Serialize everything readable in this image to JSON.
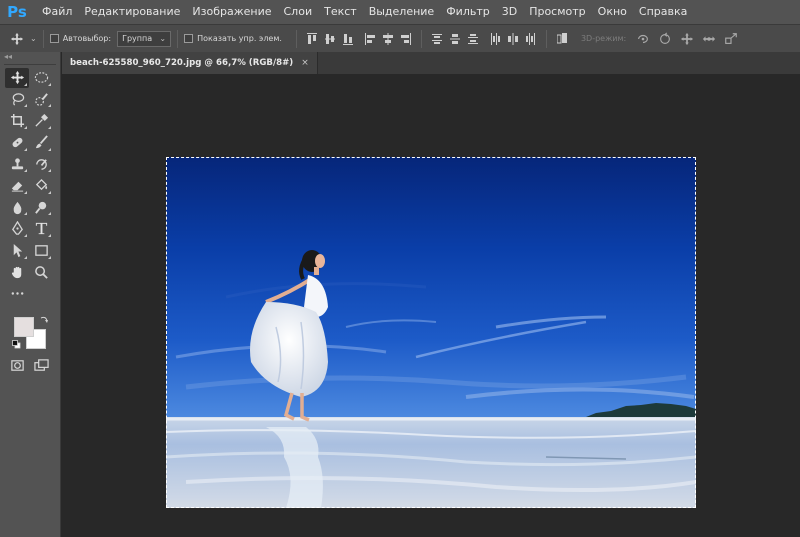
{
  "app": {
    "logo": "Ps"
  },
  "menu": [
    "Файл",
    "Редактирование",
    "Изображение",
    "Слои",
    "Текст",
    "Выделение",
    "Фильтр",
    "3D",
    "Просмотр",
    "Окно",
    "Справка"
  ],
  "options": {
    "autoselect_label": "Автовыбор:",
    "autoselect_value": "Группа",
    "show_transform_label": "Показать упр. элем.",
    "mode3d_label": "3D-режим:"
  },
  "document": {
    "tab_title": "beach-625580_960_720.jpg @ 66,7% (RGB/8#)",
    "close_glyph": "×"
  },
  "colors": {
    "foreground": "#e5dfdf",
    "background": "#ffffff",
    "accent": "#31a8ff"
  },
  "tools": [
    [
      "move-tool",
      "marquee-ellipse-tool"
    ],
    [
      "lasso-tool",
      "quick-selection-tool"
    ],
    [
      "crop-tool",
      "eyedropper-tool"
    ],
    [
      "healing-brush-tool",
      "brush-tool"
    ],
    [
      "clone-stamp-tool",
      "history-brush-tool"
    ],
    [
      "eraser-tool",
      "paint-bucket-tool"
    ],
    [
      "blur-tool",
      "dodge-tool"
    ],
    [
      "pen-tool",
      "type-tool"
    ],
    [
      "path-selection-tool",
      "rectangle-tool"
    ],
    [
      "hand-tool",
      "zoom-tool"
    ],
    [
      "more-tools"
    ]
  ]
}
